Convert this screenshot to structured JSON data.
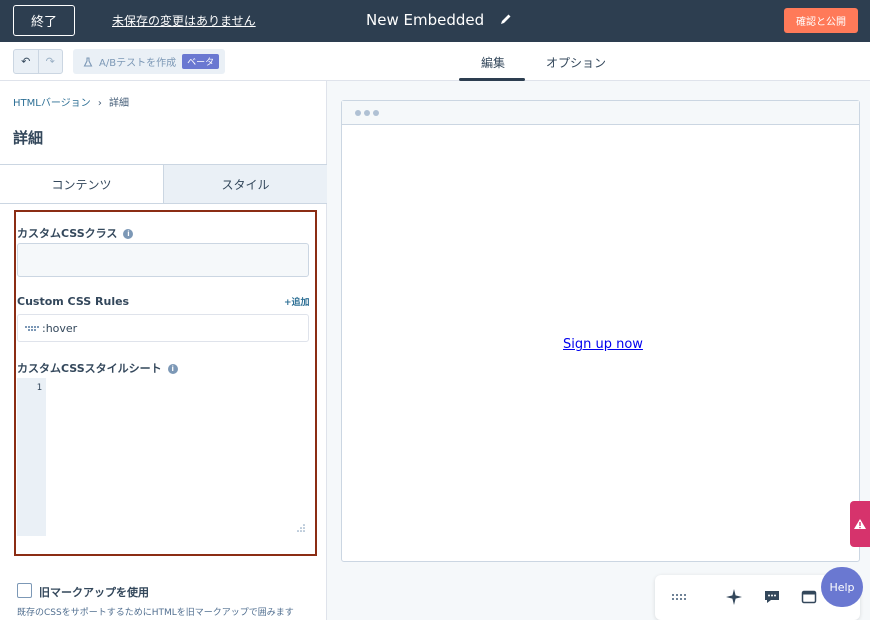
{
  "header": {
    "exit_label": "終了",
    "unsaved_text": "未保存の変更はありません",
    "title": "New Embedded",
    "publish_label": "確認と公開"
  },
  "toolbar": {
    "abtest_label": "A/Bテストを作成",
    "beta_badge": "ベータ",
    "tabs": [
      {
        "label": "編集",
        "active": true
      },
      {
        "label": "オプション",
        "active": false
      }
    ]
  },
  "sidebar": {
    "breadcrumb": {
      "parent": "HTMLバージョン",
      "separator": "›",
      "current": "詳細"
    },
    "title": "詳細",
    "subtabs": [
      {
        "label": "コンテンツ",
        "active": true
      },
      {
        "label": "スタイル",
        "active": false
      }
    ],
    "custom_css_class_label": "カスタムCSSクラス",
    "custom_css_class_value": "",
    "custom_css_rules_label": "Custom CSS Rules",
    "add_label": "+追加",
    "rules": [
      ":hover"
    ],
    "stylesheet_label": "カスタムCSSスタイルシート",
    "editor_line_number": "1",
    "legacy_markup_label": "旧マークアップを使用",
    "legacy_markup_checked": false,
    "legacy_markup_help": "既存のCSSをサポートするためにHTMLを旧マークアップで囲みます"
  },
  "preview": {
    "link_text": "Sign up now"
  },
  "help": {
    "label": "Help"
  },
  "colors": {
    "header_bg": "#2d3e50",
    "publish_bg": "#ff7a59",
    "beta_bg": "#6a78d1",
    "highlight_border": "#8b2d14",
    "link": "#0000ee",
    "warning": "#d6336c"
  }
}
